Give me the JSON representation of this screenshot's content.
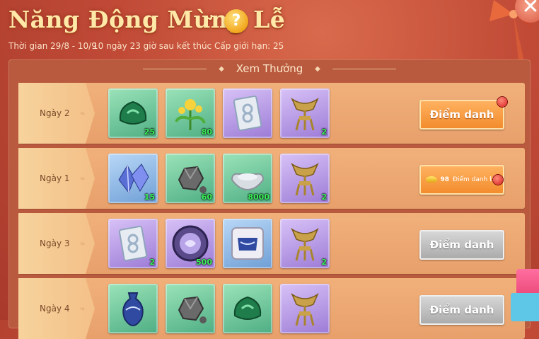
{
  "header": {
    "title": "Năng Động Mừng Lễ",
    "help_symbol": "?",
    "time_label": "Thời gian",
    "date_range": "29/8 - 10/9",
    "countdown": "10 ngày 23 giờ sau kết thúc",
    "level_limit": "Cấp giới hạn: 25",
    "close_symbol": "✕"
  },
  "panel": {
    "title": "Xem Thưởng"
  },
  "rows": [
    {
      "day": "Ngày 2",
      "items": [
        {
          "icon": "jade-pouch-icon",
          "qty": "25",
          "frame": "green"
        },
        {
          "icon": "yellow-flower-herb-icon",
          "qty": "80",
          "frame": "green"
        },
        {
          "icon": "silver-card-icon",
          "qty": "",
          "frame": "purple"
        },
        {
          "icon": "bronze-goblet-icon",
          "qty": "2",
          "frame": "purple"
        }
      ],
      "button": {
        "label": "Điểm danh",
        "style": "orange",
        "has_dot": true
      }
    },
    {
      "day": "Ngày 1",
      "items": [
        {
          "icon": "blue-crystal-icon",
          "qty": "15",
          "frame": "blue"
        },
        {
          "icon": "grey-ore-icon",
          "qty": "60",
          "frame": "green"
        },
        {
          "icon": "silver-ingot-icon",
          "qty": "8000",
          "frame": "green"
        },
        {
          "icon": "bronze-goblet-icon",
          "qty": "2",
          "frame": "purple"
        }
      ],
      "button": {
        "label": "Điểm danh bù",
        "cost": "98",
        "style": "makeup",
        "has_dot": true
      }
    },
    {
      "day": "Ngày 3",
      "items": [
        {
          "icon": "silver-card-icon",
          "qty": "2",
          "frame": "purple"
        },
        {
          "icon": "purple-coin-icon",
          "qty": "500",
          "frame": "purple"
        },
        {
          "icon": "porcelain-puzzle-icon",
          "qty": "",
          "frame": "blue"
        },
        {
          "icon": "bronze-goblet-icon",
          "qty": "2",
          "frame": "purple"
        }
      ],
      "button": {
        "label": "Điểm danh",
        "style": "gray",
        "has_dot": false
      }
    },
    {
      "day": "Ngày 4",
      "items": [
        {
          "icon": "porcelain-vase-icon",
          "qty": "",
          "frame": "green"
        },
        {
          "icon": "grey-ore-icon",
          "qty": "",
          "frame": "green"
        },
        {
          "icon": "jade-pouch-icon",
          "qty": "",
          "frame": "green"
        },
        {
          "icon": "bronze-goblet-icon",
          "qty": "",
          "frame": "purple"
        }
      ],
      "button": {
        "label": "Điểm danh",
        "style": "gray",
        "has_dot": false
      }
    }
  ],
  "colors": {
    "title": "#ffe9a8",
    "date_green": "#3bf05a",
    "qty_green": "#3bf05a",
    "button_orange": "#f28a2a",
    "button_gray": "#a9a9a9"
  }
}
